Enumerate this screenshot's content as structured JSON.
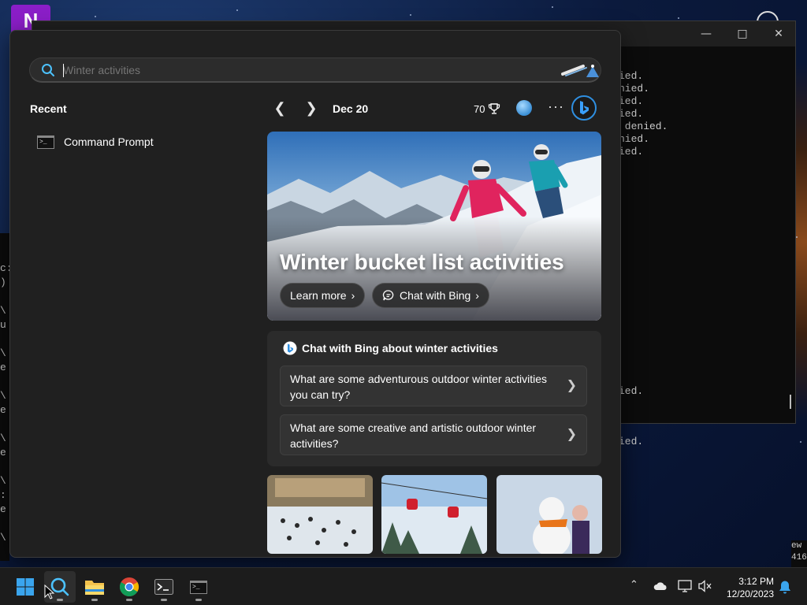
{
  "search": {
    "placeholder": "Winter activities",
    "value": ""
  },
  "recent": {
    "heading": "Recent",
    "items": [
      {
        "label": "Command Prompt",
        "icon": "command-prompt-icon"
      }
    ]
  },
  "nav": {
    "date": "Dec 20",
    "points": "70"
  },
  "hero": {
    "title": "Winter bucket list activities",
    "learn_more": "Learn more",
    "chat_with_bing": "Chat with Bing"
  },
  "chat": {
    "heading": "Chat with Bing about winter activities",
    "suggestions": [
      "What are some adventurous outdoor winter activities you can try?",
      "What are some creative and artistic outdoor winter activities?"
    ]
  },
  "terminal": {
    "lines": [
      "ied.",
      "nied.",
      "ied.",
      "ied.",
      " denied.",
      "nied.",
      "ied.",
      "",
      "",
      "",
      "",
      "",
      "",
      "",
      "",
      "",
      "",
      "",
      "",
      "",
      "",
      "",
      "",
      "",
      "",
      "ied.",
      "",
      "",
      "",
      "ied."
    ]
  },
  "left_terminal": {
    "lines": [
      "",
      "",
      "c:",
      ")",
      "",
      "\\",
      "u",
      "",
      "\\",
      "e",
      "",
      "\\",
      "e",
      "",
      "\\",
      "e",
      "",
      "\\",
      ":",
      "e",
      "",
      "\\"
    ]
  },
  "right_terminal": {
    "lines": [
      "ew",
      "416"
    ]
  },
  "taskbar": {
    "time": "3:12 PM",
    "date": "12/20/2023"
  },
  "colors": {
    "accent": "#2f8fe0",
    "flyout_bg": "#202020",
    "card_bg": "#2b2b2b"
  }
}
